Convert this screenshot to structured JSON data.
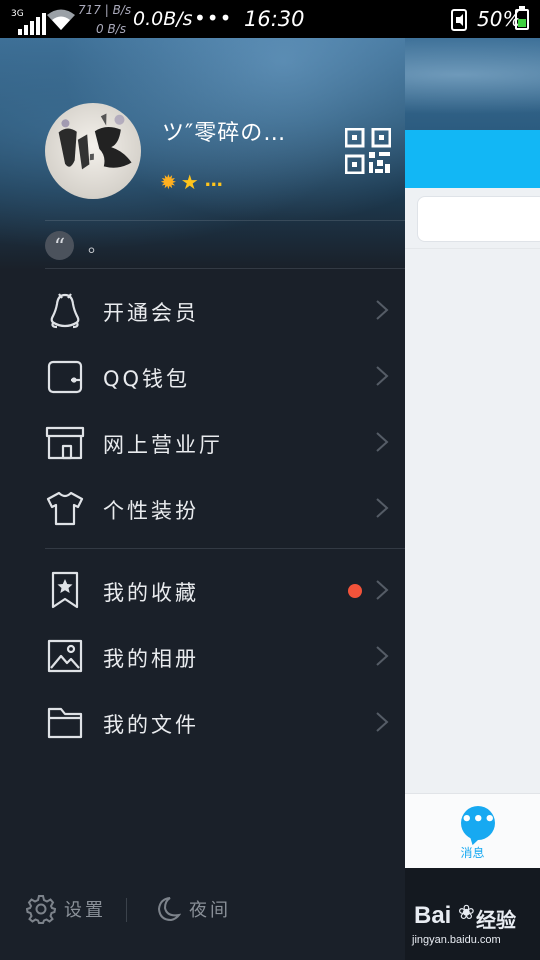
{
  "status_bar": {
    "network_type": "3G",
    "speed_up": "717 | B/s",
    "speed_down": "0 B/s",
    "speed_main": "0.0B/s",
    "more_dots": "•••",
    "time": "16:30",
    "battery_percent": "50%",
    "battery_level": 0.5
  },
  "profile": {
    "nickname": "ツ″零碎の…",
    "level_more": "…",
    "signature": "。"
  },
  "menu": {
    "items": [
      {
        "label": "开通会员",
        "icon": "penguin-icon"
      },
      {
        "label": "QQ钱包",
        "icon": "wallet-icon"
      },
      {
        "label": "网上营业厅",
        "icon": "store-icon"
      },
      {
        "label": "个性装扮",
        "icon": "tshirt-icon"
      },
      {
        "label": "我的收藏",
        "icon": "bookmark-star-icon",
        "has_badge": true
      },
      {
        "label": "我的相册",
        "icon": "photo-icon"
      },
      {
        "label": "我的文件",
        "icon": "folder-icon"
      }
    ]
  },
  "bottom": {
    "settings_label": "设置",
    "night_label": "夜间"
  },
  "peek": {
    "tab_message_label": "消息",
    "tab_message_icon": "•••"
  },
  "watermark": {
    "brand": "Bai",
    "product": "经验",
    "url": "jingyan.baidu.com"
  },
  "colors": {
    "accent": "#12b7f5",
    "badge": "#f2533a",
    "drawer_bg": "#1a2029"
  }
}
